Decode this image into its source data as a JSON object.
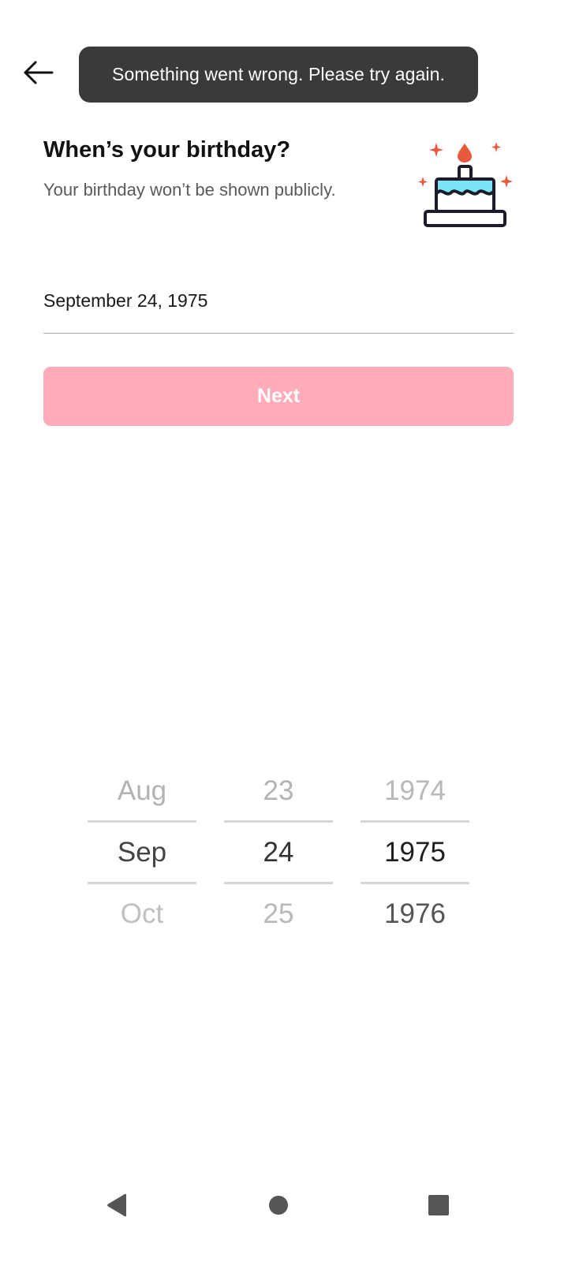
{
  "toast": {
    "message": "Something went wrong. Please try again."
  },
  "header": {
    "title": "When’s your birthday?",
    "subtitle": "Your birthday won’t be shown publicly."
  },
  "birthday_field": {
    "value": "September 24, 1975"
  },
  "next_button": {
    "label": "Next",
    "color": "#ffacba",
    "enabled": false
  },
  "date_picker": {
    "month": {
      "previous": "Aug",
      "selected": "Sep",
      "next": "Oct"
    },
    "day": {
      "previous": "23",
      "selected": "24",
      "next": "25"
    },
    "year": {
      "previous": "1974",
      "selected": "1975",
      "next": "1976"
    }
  },
  "colors": {
    "toast_background": "#3a3a3a",
    "cake_accent": "#e85a3c",
    "cake_frosting": "#7ae6f5",
    "selected_text": "#222222",
    "unselected_text": "#b3b3b3"
  },
  "icons": {
    "back": "arrow-left-icon",
    "illustration": "birthday-cake-icon",
    "nav_back": "triangle-back-icon",
    "nav_home": "circle-home-icon",
    "nav_recents": "square-recents-icon"
  }
}
